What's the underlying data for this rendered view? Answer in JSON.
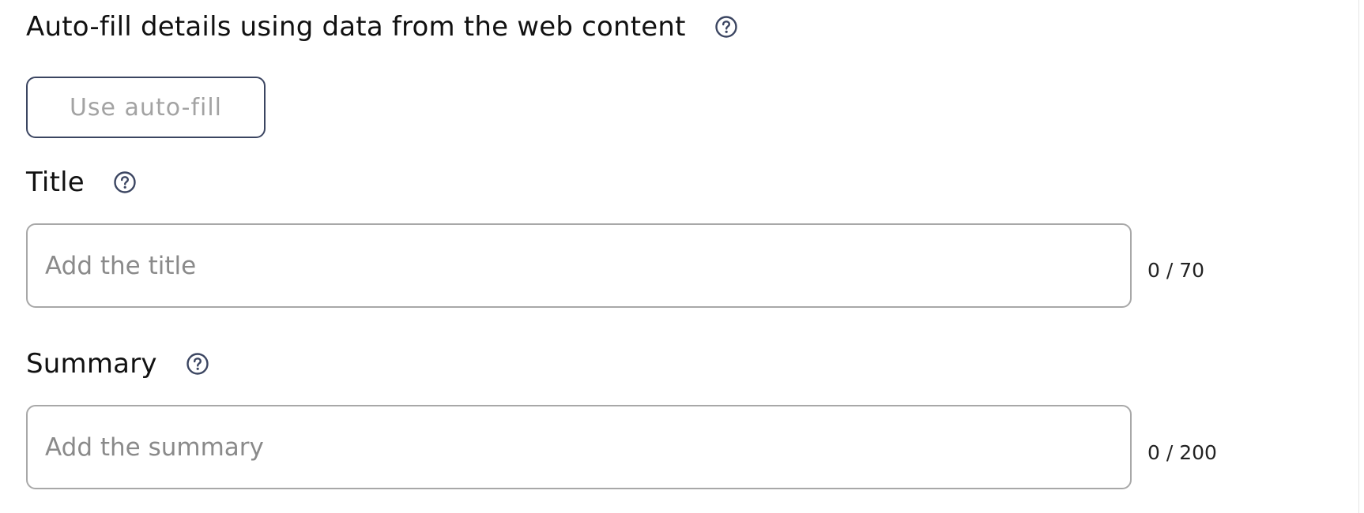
{
  "autofill": {
    "heading": "Auto-fill details using data from the web content",
    "help_icon": "question-circle-icon",
    "button_label": "Use auto-fill"
  },
  "title": {
    "label": "Title",
    "help_icon": "question-circle-icon",
    "placeholder": "Add the title",
    "value": "",
    "counter": "0 / 70"
  },
  "summary": {
    "label": "Summary",
    "help_icon": "question-circle-icon",
    "placeholder": "Add the summary",
    "value": "",
    "counter": "0 / 200"
  },
  "colors": {
    "icon": "#3b4561",
    "button_border": "#3b4561",
    "button_text_disabled": "#a3a3a3",
    "input_border": "#a8a8a8",
    "placeholder": "#8a8a8a"
  }
}
